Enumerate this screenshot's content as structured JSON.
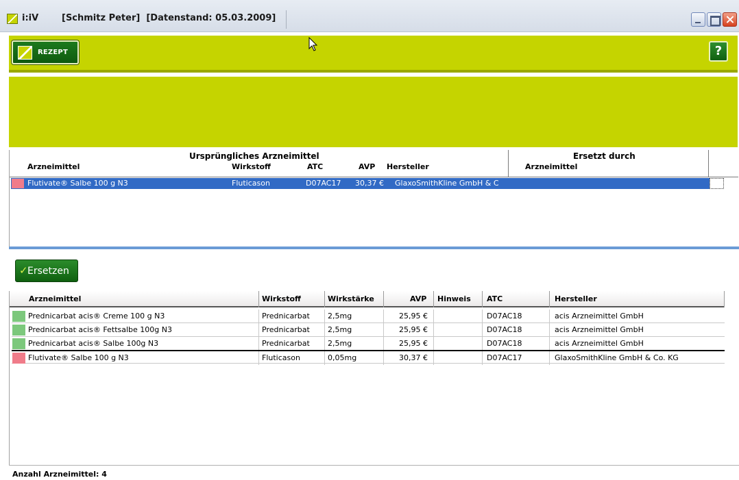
{
  "window": {
    "app_name": "i:iV",
    "title": "[Schmitz Peter]  [Datenstand: 05.03.2009]",
    "icon": "app-logo-icon"
  },
  "toolbar": {
    "rezept_label": "REZEPT",
    "help_label": "?"
  },
  "upper_table": {
    "group_original": "Ursprüngliches Arzneimittel",
    "group_replaced": "Ersetzt durch",
    "headers": {
      "arzneimittel": "Arzneimittel",
      "wirkstoff": "Wirkstoff",
      "atc": "ATC",
      "avp": "AVP",
      "hersteller": "Hersteller",
      "ersetzt_arzneimittel": "Arzneimittel"
    },
    "row": {
      "arzneimittel": "Flutivate® Salbe 100 g N3",
      "wirkstoff": "Fluticason",
      "atc": "D07AC17",
      "avp": "30,37 €",
      "hersteller": "GlaxoSmithKline GmbH & C",
      "status_color": "#f07c8a"
    }
  },
  "ersetzen": {
    "check": "✓",
    "label": "Ersetzen"
  },
  "lower_table": {
    "headers": {
      "arzneimittel": "Arzneimittel",
      "wirkstoff": "Wirkstoff",
      "wirkstaerke": "Wirkstärke",
      "avp": "AVP",
      "hinweis": "Hinweis",
      "atc": "ATC",
      "hersteller": "Hersteller"
    },
    "rows": [
      {
        "arzneimittel": "Prednicarbat acis® Creme 100 g N3",
        "wirkstoff": "Prednicarbat",
        "wirkstaerke": "2,5mg",
        "avp": "25,95 €",
        "hinweis": "",
        "atc": "D07AC18",
        "hersteller": "acis Arzneimittel GmbH",
        "status_color": "#7cc87c"
      },
      {
        "arzneimittel": "Prednicarbat acis® Fettsalbe 100g N3",
        "wirkstoff": "Prednicarbat",
        "wirkstaerke": "2,5mg",
        "avp": "25,95 €",
        "hinweis": "",
        "atc": "D07AC18",
        "hersteller": "acis Arzneimittel GmbH",
        "status_color": "#7cc87c"
      },
      {
        "arzneimittel": "Prednicarbat acis® Salbe 100g N3",
        "wirkstoff": "Prednicarbat",
        "wirkstaerke": "2,5mg",
        "avp": "25,95 €",
        "hinweis": "",
        "atc": "D07AC18",
        "hersteller": "acis Arzneimittel GmbH",
        "status_color": "#7cc87c"
      },
      {
        "arzneimittel": "Flutivate® Salbe 100 g N3",
        "wirkstoff": "Fluticason",
        "wirkstaerke": "0,05mg",
        "avp": "30,37 €",
        "hinweis": "",
        "atc": "D07AC17",
        "hersteller": "GlaxoSmithKline GmbH & Co. KG",
        "status_color": "#f07c8a"
      }
    ]
  },
  "status": {
    "count_text": "Anzahl Arzneimittel: 4"
  },
  "colors": {
    "brand_lime": "#c5d400",
    "selection_blue": "#316ac5",
    "button_green": "#1d7a1d"
  }
}
